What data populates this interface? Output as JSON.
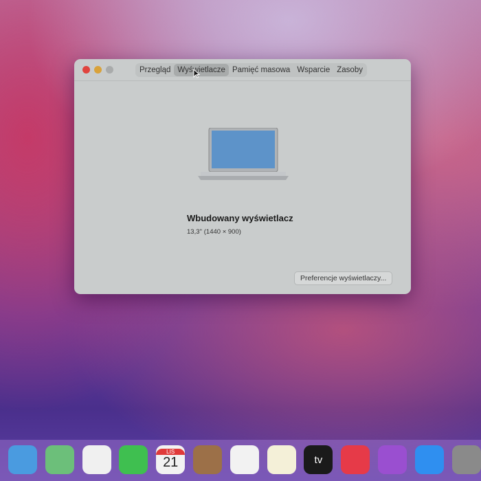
{
  "window": {
    "tabs": [
      "Przegląd",
      "Wyświetlacze",
      "Pamięć masowa",
      "Wsparcie",
      "Zasoby"
    ],
    "active_tab": "Wyświetlacze",
    "display_name": "Wbudowany wyświetlacz",
    "display_spec": "13,3'' (1440 × 900)",
    "preferences_button": "Preferencje wyświetlaczy..."
  },
  "dock": {
    "apps": [
      {
        "name": "mail-icon",
        "color": "#4a9be0"
      },
      {
        "name": "maps-icon",
        "color": "#6cbf7a"
      },
      {
        "name": "photos-icon",
        "color": "#f0f0f0"
      },
      {
        "name": "facetime-icon",
        "color": "#3fbf50"
      },
      {
        "name": "calendar-icon",
        "color": "#f2f2f2"
      },
      {
        "name": "contacts-icon",
        "color": "#9c7048"
      },
      {
        "name": "reminders-icon",
        "color": "#f2f2f2"
      },
      {
        "name": "notes-icon",
        "color": "#f4f0d8"
      },
      {
        "name": "tv-icon",
        "color": "#1a1a1a"
      },
      {
        "name": "music-icon",
        "color": "#e63a48"
      },
      {
        "name": "podcasts-icon",
        "color": "#9a4fd0"
      },
      {
        "name": "app-store-icon",
        "color": "#2f8ff0"
      },
      {
        "name": "system-preferences-icon",
        "color": "#8a8a8a"
      }
    ],
    "calendar_month": "LIS",
    "calendar_day": "21",
    "tv_label": "tv"
  }
}
